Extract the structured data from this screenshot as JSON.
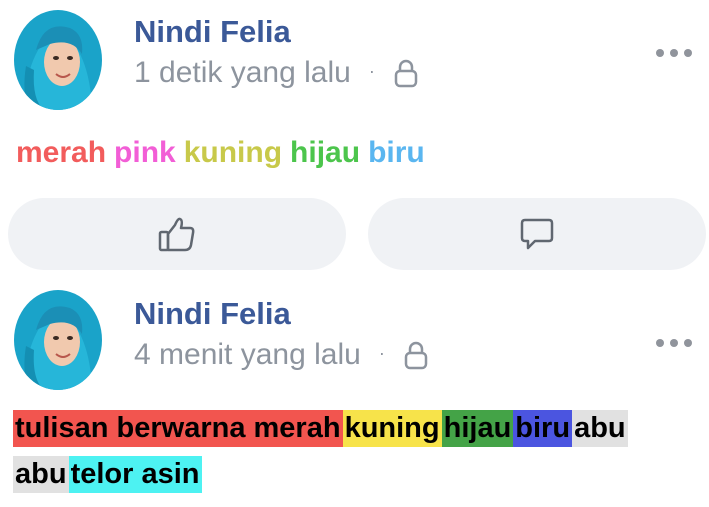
{
  "posts": [
    {
      "author": "Nindi Felia",
      "time": "1 detik yang lalu",
      "dot": "·",
      "color_words": [
        {
          "text": "merah",
          "color": "#f25c5c"
        },
        {
          "text": "pink",
          "color": "#f25ed6"
        },
        {
          "text": "kuning",
          "color": "#c8c94a"
        },
        {
          "text": "hijau",
          "color": "#4cc54c"
        },
        {
          "text": "biru",
          "color": "#5ab6f0"
        }
      ]
    },
    {
      "author": "Nindi Felia",
      "time": "4 menit yang lalu",
      "dot": "·",
      "highlight_segments": [
        {
          "text": "tulisan berwarna merah",
          "bg": "#f2554f"
        },
        {
          "text": "kuning",
          "bg": "#f7e34a"
        },
        {
          "text": "hijau",
          "bg": "#44a347"
        },
        {
          "text": "biru",
          "bg": "#4b55e0"
        },
        {
          "text": "abu",
          "bg": "#e1e1e1"
        },
        {
          "text": "abu",
          "bg": "#e1e1e1"
        },
        {
          "text": "telor asin",
          "bg": "#4df2f2"
        }
      ]
    }
  ],
  "icons": {
    "more": "more-options-icon",
    "privacy": "lock-icon",
    "like": "thumbs-up-icon",
    "comment": "comment-icon"
  }
}
